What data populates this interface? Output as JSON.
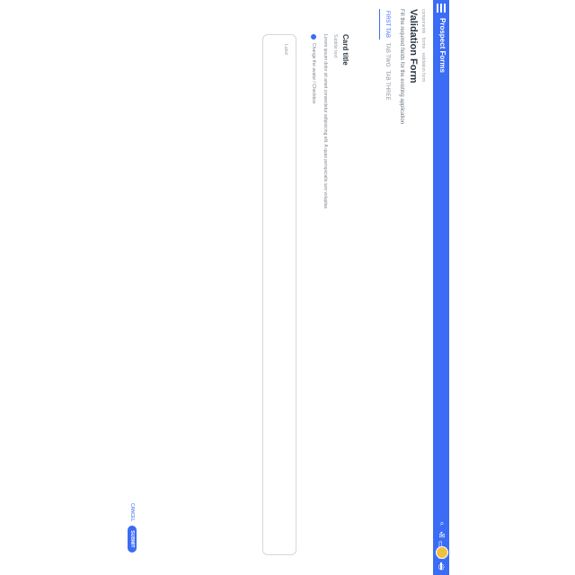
{
  "header": {
    "brand": "Prospect Forms",
    "accent_color": "#3b6cf6"
  },
  "breadcrumbs": [
    "components",
    "forms",
    "validation form"
  ],
  "page": {
    "title": "Validation Form",
    "subtitle": "Fill the required fields for the existing application"
  },
  "tabs": [
    {
      "label": "FIRST TAB",
      "active": true
    },
    {
      "label": "TAB TWO",
      "active": false
    },
    {
      "label": "TAB THREE",
      "active": false
    }
  ],
  "card": {
    "title": "Card title",
    "subtitle": "Subtitle text",
    "text": "Lorem ipsum dolor sit amet consectetur adipisicing elit. A quas perspiciatis iure voluptas"
  },
  "checkbox": {
    "label": "Change the avatar / Checkbox"
  },
  "textarea": {
    "placeholder": "Label"
  },
  "actions": {
    "cancel": "CANCEL",
    "submit": "SUBMIT"
  }
}
